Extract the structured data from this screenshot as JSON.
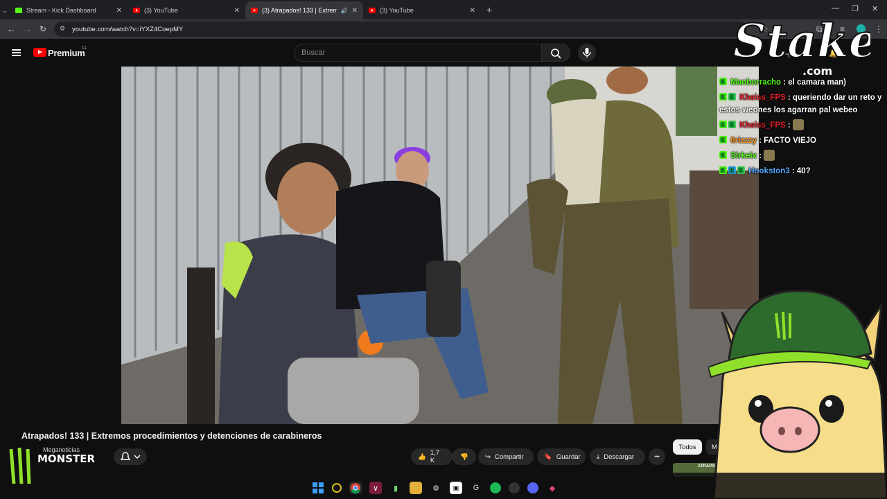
{
  "browser": {
    "tabs": [
      {
        "title": "Stream - Kick Dashboard",
        "icon": "kick-icon",
        "active": false
      },
      {
        "title": "(3) YouTube",
        "icon": "youtube-icon",
        "active": false
      },
      {
        "title": "(3) Atrapados! 133 | Extrem",
        "icon": "youtube-icon",
        "active": true
      },
      {
        "title": "(3) YouTube",
        "icon": "youtube-icon",
        "active": false
      }
    ],
    "new_tab": "+",
    "url": "youtube.com/watch?v=iYXZ4CoepMY"
  },
  "youtube": {
    "brand": "Premium",
    "country": "CL",
    "search_placeholder": "Buscar",
    "video_title": "Atrapados! 133 | Extremos procedimientos y detenciones de carabineros",
    "channel_name": "Meganoticias",
    "like_count": "1,7 K",
    "share_label": "Compartir",
    "save_label": "Guardar",
    "download_label": "Descargar",
    "more_label": "•••",
    "chip_all": "Todos",
    "chip_next": "M",
    "thumb_text": "ATRAPADOS!"
  },
  "overlay": {
    "sponsor_logo": "Stake",
    "sponsor_domain": ".com",
    "chat": [
      {
        "user": "Manborracho",
        "text": ": el camara man)",
        "user_color": "#53fc18"
      },
      {
        "user": "Kheiss_FPS",
        "text": ": queriendo dar un reto y estos weones los agarran pal webeo",
        "user_color": "#e0202a"
      },
      {
        "user": "Kheiss_FPS",
        "text": ":",
        "user_color": "#e0202a"
      },
      {
        "user": "6rizzzy",
        "text": ": FACTO VIEJO",
        "user_color": "#ff9a1f"
      },
      {
        "user": "Sirkeix",
        "text": ":",
        "user_color": "#53fc18"
      },
      {
        "user": "Hookston3",
        "text": ": 40?",
        "user_color": "#55aaff"
      }
    ],
    "brand_logo": "MONSTER"
  },
  "colors": {
    "yt_red": "#ff0000",
    "kick_green": "#53fc18",
    "bg": "#0f0f0f"
  }
}
